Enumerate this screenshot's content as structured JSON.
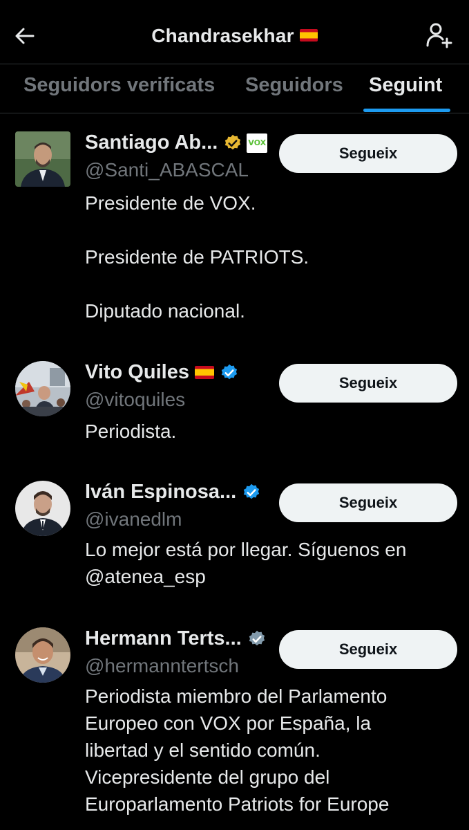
{
  "header": {
    "title": "Chandrasekhar"
  },
  "tabs": [
    {
      "label": "Seguidors verificats",
      "active": false
    },
    {
      "label": "Seguidors",
      "active": false
    },
    {
      "label": "Seguint",
      "active": true
    }
  ],
  "colors": {
    "background": "#000000",
    "accent": "#1d9bf0",
    "verified_gold": "#e8b832",
    "verified_blue": "#1d9bf0",
    "verified_gray": "#829aab"
  },
  "users": [
    {
      "name": "Santiago Ab...",
      "handle": "@Santi_ABASCAL",
      "badge": "gold-verified-icon",
      "affiliate_logo": "VOX",
      "follow_label": "Segueix",
      "bio": "Presidente de VOX.\n\nPresidente de PATRIOTS.\n\nDiputado nacional."
    },
    {
      "name": "Vito Quiles",
      "handle": "@vitoquiles",
      "badge": "blue-verified-icon",
      "follow_label": "Segueix",
      "bio": "Periodista."
    },
    {
      "name": "Iván Espinosa...",
      "handle": "@ivanedlm",
      "badge": "blue-verified-icon",
      "follow_label": "Segueix",
      "bio": "Lo mejor está por llegar. Síguenos en\n@atenea_esp"
    },
    {
      "name": "Hermann Terts...",
      "handle": "@hermanntertsch",
      "badge": "gray-verified-icon",
      "follow_label": "Segueix",
      "bio": "Periodista miembro del Parlamento\nEuropeo con VOX por España, la\nlibertad y el sentido común.\nVicepresidente del grupo del\nEuroparlamento Patriots for Europe"
    }
  ]
}
